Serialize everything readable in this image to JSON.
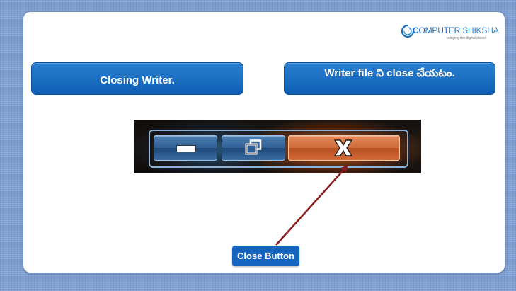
{
  "logo": {
    "brand_c": "C",
    "brand_rest": "OMPUTER",
    "brand_second": " SHIKSHA",
    "tagline": "bridging the digital divide"
  },
  "pills": {
    "left": "Closing Writer.",
    "right": "Writer file ని close చేయటం."
  },
  "callout": {
    "label": "Close Button"
  },
  "colors": {
    "pill_blue": "#0e5fb5",
    "label_blue": "#1565c0",
    "arrow": "#8b1a1a",
    "brand": "#1b6fc1"
  },
  "icons": [
    "minimize-icon",
    "restore-icon",
    "close-x-icon",
    "computer-shiksha-logo-icon"
  ]
}
